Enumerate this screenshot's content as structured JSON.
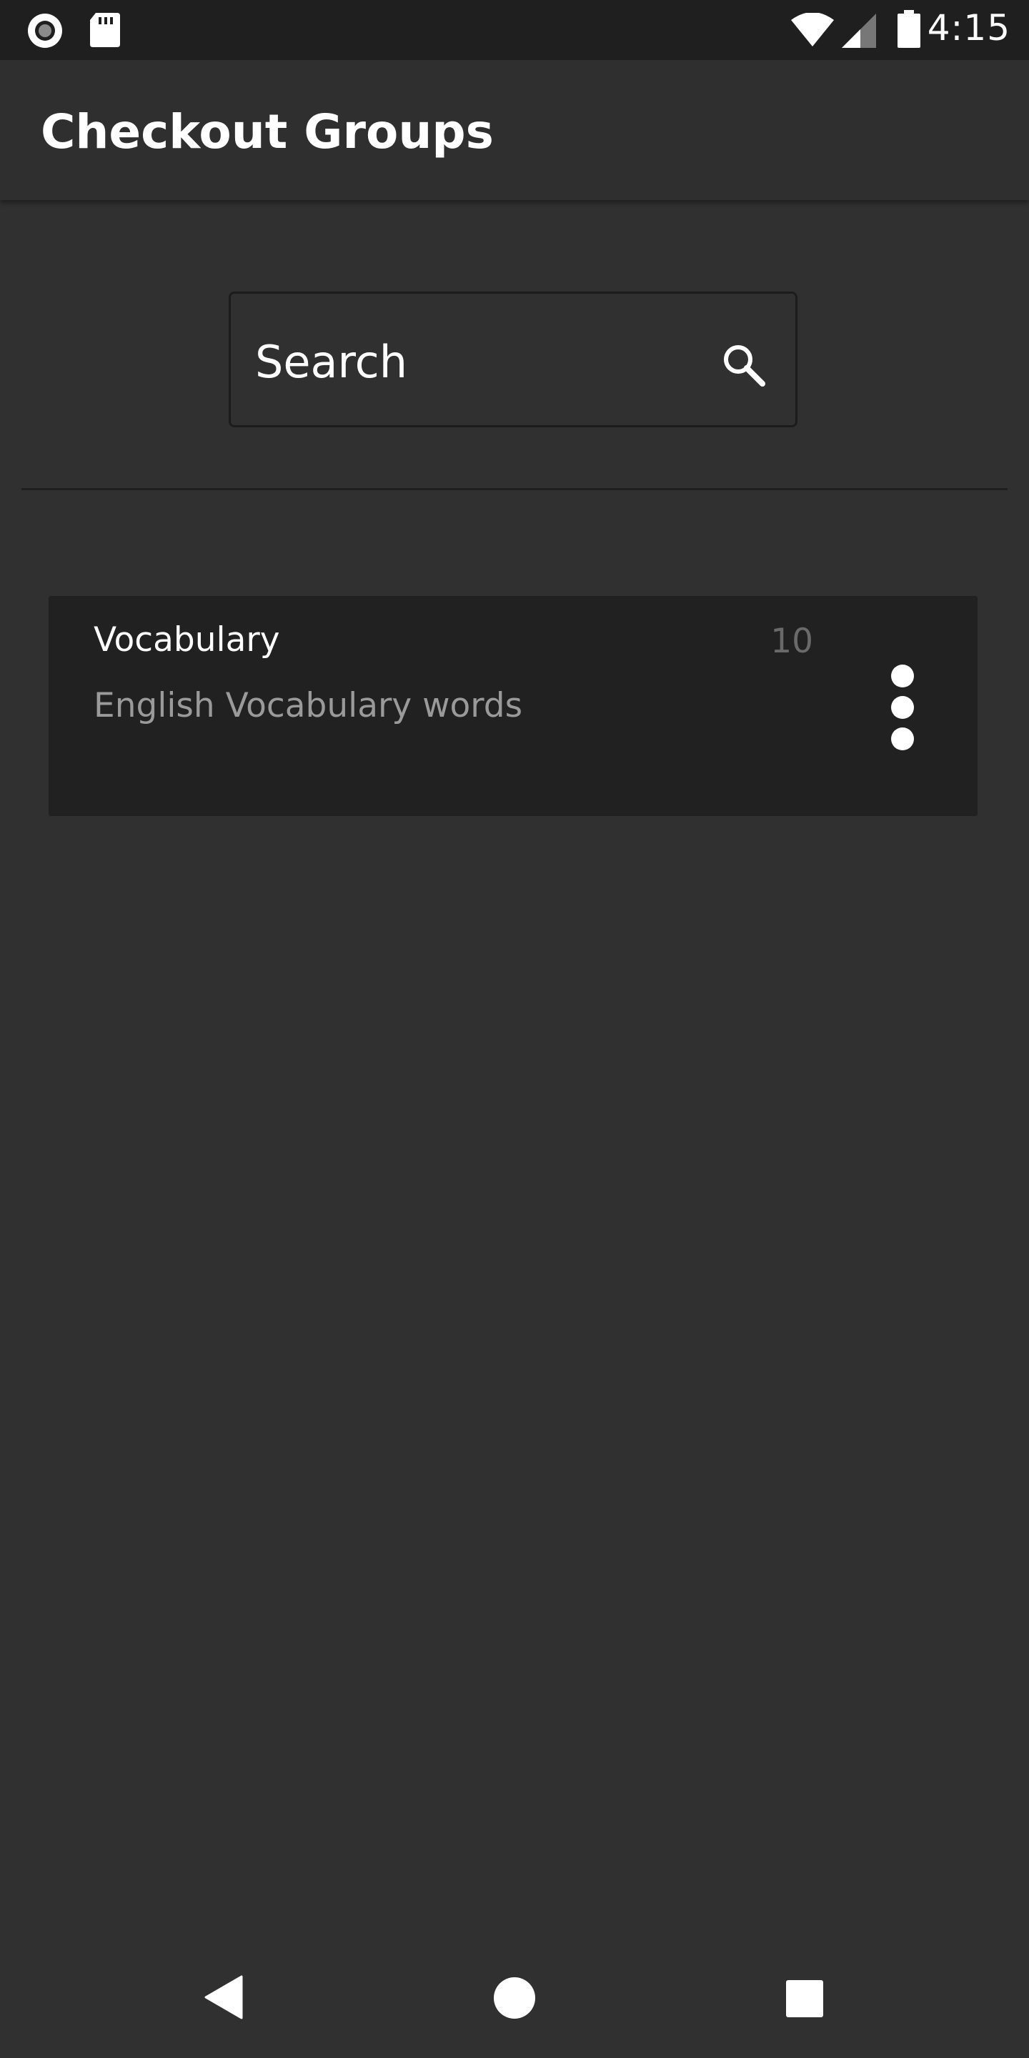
{
  "status_bar": {
    "time": "4:15",
    "left_icons": [
      "record-icon",
      "sd-card-icon"
    ],
    "right_icons": [
      "wifi-icon",
      "cell-signal-icon",
      "battery-icon"
    ]
  },
  "app_bar": {
    "title": "Checkout Groups"
  },
  "search": {
    "placeholder": "Search",
    "icon": "search-icon"
  },
  "groups": [
    {
      "name": "Vocabulary",
      "description": "English Vocabulary words",
      "count": "10",
      "menu_icon": "more-vert-icon"
    }
  ],
  "nav_bar": {
    "buttons": [
      "back-icon",
      "home-icon",
      "recents-icon"
    ]
  },
  "colors": {
    "background": "#303030",
    "status_bar": "#1f1f1f",
    "app_bar": "#2f2f2f",
    "card": "#212121",
    "text_primary": "#ffffff",
    "text_secondary": "#9a9a9a",
    "text_count": "#6a6a6a"
  }
}
